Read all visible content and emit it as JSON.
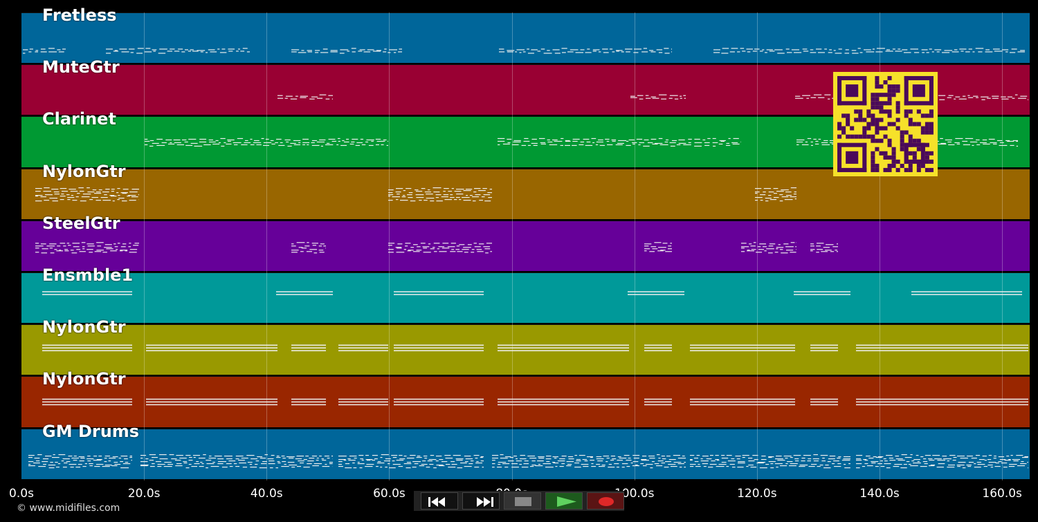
{
  "tracks": [
    {
      "name": "Fretless",
      "color": "#00669a"
    },
    {
      "name": "MuteGtr",
      "color": "#990033"
    },
    {
      "name": "Clarinet",
      "color": "#009933"
    },
    {
      "name": "NylonGtr",
      "color": "#996600"
    },
    {
      "name": "SteelGtr",
      "color": "#660099"
    },
    {
      "name": "Ensmble1",
      "color": "#009999"
    },
    {
      "name": "NylonGtr",
      "color": "#999900"
    },
    {
      "name": "NylonGtr",
      "color": "#992600"
    },
    {
      "name": "GM Drums",
      "color": "#00669a"
    }
  ],
  "timeline": {
    "ticks": [
      "0.0s",
      "20.0s",
      "40.0s",
      "60.0s",
      "80.0s",
      "100.0s",
      "120.0s",
      "140.0s",
      "160.0s"
    ],
    "tick_seconds": [
      0,
      20,
      40,
      60,
      80,
      100,
      120,
      140,
      160
    ],
    "max_seconds": 164.5
  },
  "transport": {
    "rewind": "rewind-icon",
    "fast_forward": "fast-forward-icon",
    "stop": "stop-icon",
    "play": "play-icon",
    "record": "record-icon"
  },
  "footer": {
    "copyright": "© www.midifiles.com"
  },
  "qr_code": {
    "icon": "qr-code-icon",
    "fg": "#4a0a5a",
    "bg": "#f6e12a"
  }
}
